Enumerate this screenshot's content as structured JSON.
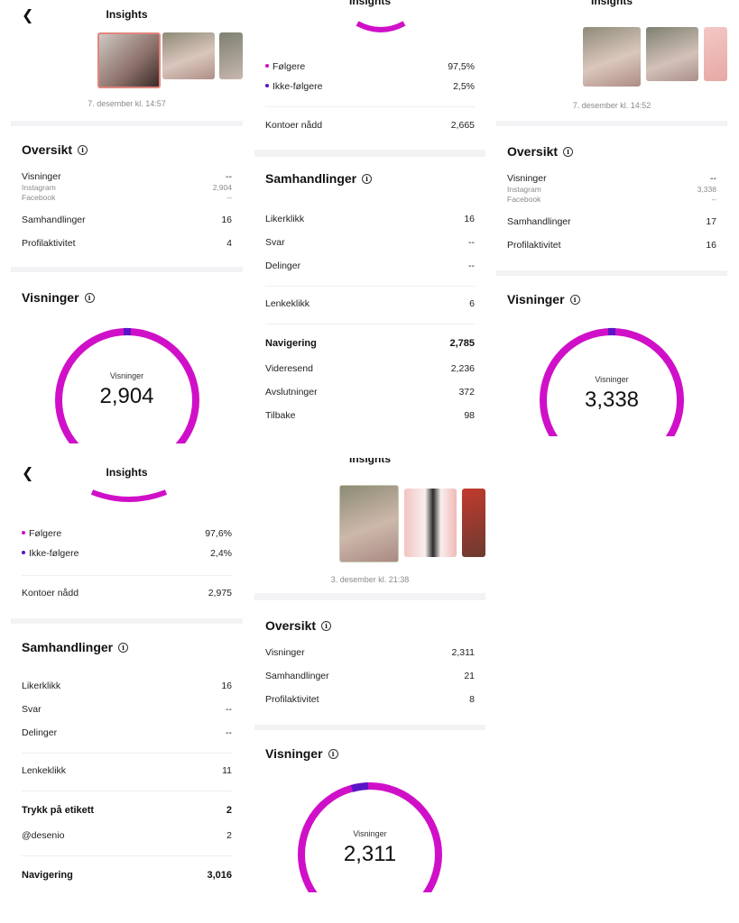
{
  "colors": {
    "ring": "#d010c8",
    "ring_accent": "#5a14c8",
    "dot_followers": "#d010c8",
    "dot_nonfollowers": "#5a14c8"
  },
  "common": {
    "header_title": "Insights",
    "back_icon": "chevron-left-icon",
    "info_icon": "info-icon",
    "info_glyph": "i",
    "oversikt": "Oversikt",
    "visninger": "Visninger",
    "instagram": "Instagram",
    "facebook": "Facebook",
    "samhandlinger": "Samhandlinger",
    "profilaktivitet": "Profilaktivitet",
    "folgere": "Følgere",
    "ikke_folgere": "Ikke-følgere",
    "kontoer_nadd": "Kontoer nådd",
    "likerklikk": "Likerklikk",
    "svar": "Svar",
    "delinger": "Delinger",
    "lenkeklikk": "Lenkeklikk",
    "navigering": "Navigering",
    "videresend": "Videresend",
    "avslutninger": "Avslutninger",
    "tilbake": "Tilbake",
    "trykk_etikett": "Trykk på etikett",
    "desenio": "@desenio",
    "dash": "--"
  },
  "panel1": {
    "date": "7. desember kl. 14:57",
    "visninger": "--",
    "instagram": "2,904",
    "facebook": "--",
    "samhandlinger": "16",
    "profilaktivitet": "4",
    "dial_value": "2,904"
  },
  "panel2": {
    "header_title": "Insights",
    "folgere": "97,5%",
    "ikke_folgere": "2,5%",
    "kontoer_nadd": "2,665",
    "likerklikk": "16",
    "svar": "--",
    "delinger": "--",
    "lenkeklikk": "6",
    "navigering": "2,785",
    "videresend": "2,236",
    "avslutninger": "372",
    "tilbake": "98"
  },
  "panel3": {
    "header_title": "Insights",
    "date": "7. desember kl. 14:52",
    "visninger": "--",
    "instagram": "3,338",
    "facebook": "--",
    "samhandlinger": "17",
    "profilaktivitet": "16",
    "dial_value": "3,338"
  },
  "panel4": {
    "folgere": "97,6%",
    "ikke_folgere": "2,4%",
    "kontoer_nadd": "2,975",
    "likerklikk": "16",
    "svar": "--",
    "delinger": "--",
    "lenkeklikk": "11",
    "trykk_etikett": "2",
    "desenio": "2",
    "navigering": "3,016"
  },
  "panel5": {
    "header_title": "Insights",
    "date": "3. desember kl. 21:38",
    "visninger": "2,311",
    "samhandlinger": "21",
    "profilaktivitet": "8",
    "dial_value": "2,311"
  }
}
